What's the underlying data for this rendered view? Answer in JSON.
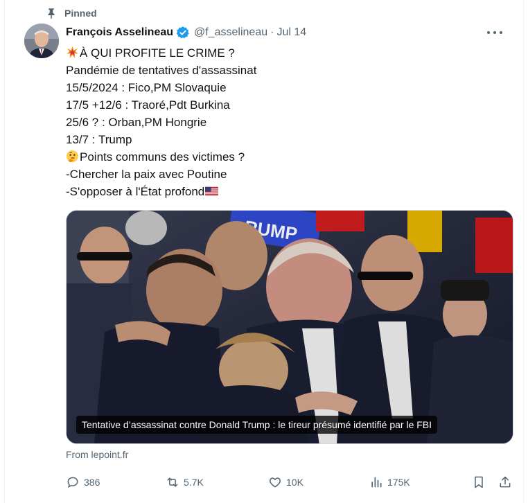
{
  "pinned_label": "Pinned",
  "author": {
    "name": "François Asselineau",
    "handle": "@f_asselineau",
    "separator": "·",
    "date": "Jul 14"
  },
  "tweet_lines": [
    "À QUI PROFITE LE CRIME ?",
    "Pandémie de tentatives d'assassinat",
    "15/5/2024 : Fico,PM Slovaquie",
    "17/5 +12/6 : Traoré,Pdt Burkina",
    "25/6 ? : Orban,PM Hongrie",
    "13/7 : Trump",
    "Points communs des victimes ?",
    "-Chercher la paix avec Poutine",
    "-S'opposer à l'État profond"
  ],
  "media": {
    "caption": "Tentative d’assassinat contre Donald Trump : le tireur présumé identifié par le FBI",
    "banner_text": "RUMP"
  },
  "source": "From lepoint.fr",
  "actions": {
    "replies": "386",
    "reposts": "5.7K",
    "likes": "10K",
    "views": "175K"
  },
  "icons": [
    "pin-icon",
    "verified-badge-icon",
    "more-options-icon",
    "collision-emoji",
    "thinking-emoji",
    "us-flag-emoji",
    "reply-icon",
    "repost-icon",
    "like-icon",
    "views-icon",
    "bookmark-icon",
    "share-icon"
  ],
  "colors": {
    "accent": "#1d9bf0",
    "muted": "#536471",
    "text": "#0f1419"
  }
}
